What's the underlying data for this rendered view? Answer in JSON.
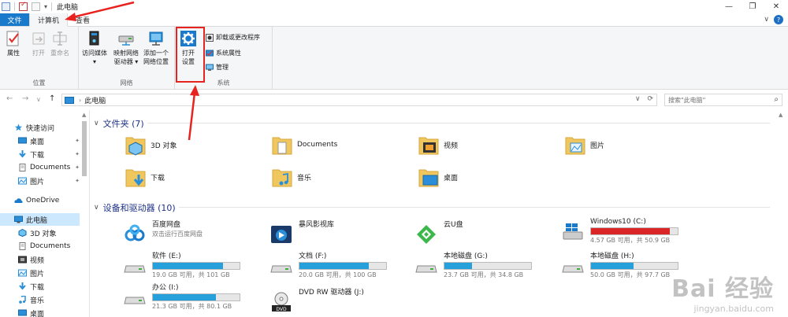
{
  "window": {
    "title": "此电脑",
    "minimize": "—",
    "restore": "❐",
    "close": "✕"
  },
  "tabs": {
    "file": "文件",
    "computer": "计算机",
    "view": "查看",
    "expand": "∨",
    "help": "?"
  },
  "ribbon": {
    "location_group": "位置",
    "network_group": "网络",
    "system_group": "系统",
    "properties": "属性",
    "open": "打开",
    "rename": "重命名",
    "access_media_line1": "访问媒体",
    "access_media_line2": "▾",
    "map_drive_line1": "映射网络",
    "map_drive_line2": "驱动器 ▾",
    "add_location_line1": "添加一个",
    "add_location_line2": "网络位置",
    "open_settings_line1": "打开",
    "open_settings_line2": "设置",
    "uninstall": "卸载或更改程序",
    "system_properties": "系统属性",
    "manage": "管理"
  },
  "address": {
    "back": "←",
    "forward": "→",
    "recent": "∨",
    "up": "↑",
    "crumb": "此电脑",
    "crumb_sep": "›",
    "dropdown": "∨",
    "refresh": "⟳",
    "search_placeholder": "搜索\"此电脑\"",
    "search_icon": "⌕"
  },
  "sidebar": {
    "quick_access": "快速访问",
    "qa_items": [
      "桌面",
      "下载",
      "Documents",
      "图片"
    ],
    "pin": "📌",
    "onedrive": "OneDrive",
    "this_pc": "此电脑",
    "pc_items": [
      "3D 对象",
      "Documents",
      "视频",
      "图片",
      "下载",
      "音乐",
      "桌面"
    ]
  },
  "main": {
    "folders_title": "文件夹 (7)",
    "folders": [
      "3D 对象",
      "Documents",
      "视频",
      "图片",
      "下载",
      "音乐",
      "桌面"
    ],
    "drives_title": "设备和驱动器 (10)",
    "chevron": "∨",
    "apps": [
      {
        "name": "百度网盘",
        "sub": "双击运行百度网盘"
      },
      {
        "name": "暴风影视库",
        "sub": ""
      },
      {
        "name": "云U盘",
        "sub": ""
      }
    ],
    "drives": [
      {
        "name": "Windows10 (C:)",
        "free": "4.57 GB 可用，共 50.9 GB",
        "used_fraction": 0.91
      },
      {
        "name": "软件 (E:)",
        "free": "19.0 GB 可用，共 101 GB",
        "used_fraction": 0.81
      },
      {
        "name": "文档 (F:)",
        "free": "20.0 GB 可用，共 100 GB",
        "used_fraction": 0.8
      },
      {
        "name": "本地磁盘 (G:)",
        "free": "23.7 GB 可用，共 34.8 GB",
        "used_fraction": 0.32
      },
      {
        "name": "本地磁盘 (H:)",
        "free": "50.0 GB 可用，共 97.7 GB",
        "used_fraction": 0.49
      },
      {
        "name": "办公 (I:)",
        "free": "21.3 GB 可用，共 80.1 GB",
        "used_fraction": 0.73
      },
      {
        "name": "DVD RW 驱动器 (J:)",
        "free": "",
        "used_fraction": 0
      }
    ],
    "dvd_label": "DVD"
  },
  "watermark": {
    "line1": "Bai 经验",
    "line2": "jingyan.baidu.com"
  },
  "colors": {
    "accent": "#1979ca",
    "highlight": "#e8231f",
    "drive_bar": "#26a0da",
    "drive_bar_full": "#da2626"
  }
}
